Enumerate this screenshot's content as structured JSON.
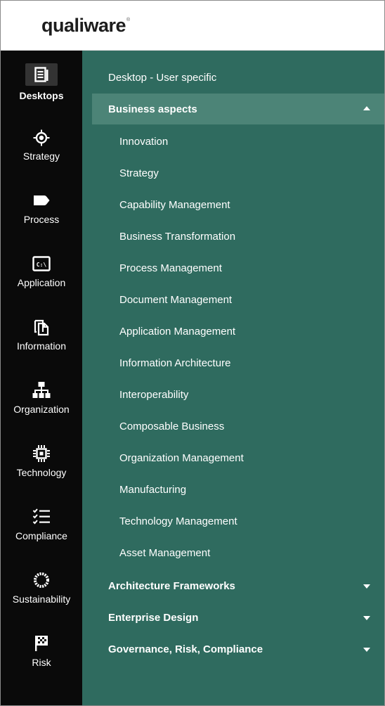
{
  "brand": {
    "name": "qualiware",
    "mark": "®"
  },
  "colors": {
    "rail": "#0a0a0a",
    "panel": "#2f6b5f",
    "active_row": "#4c8477",
    "text": "#ffffff"
  },
  "rail": {
    "items": [
      {
        "label": "Desktops",
        "icon": "desktops-icon",
        "active": true
      },
      {
        "label": "Strategy",
        "icon": "target-icon"
      },
      {
        "label": "Process",
        "icon": "process-tag-icon"
      },
      {
        "label": "Application",
        "icon": "terminal-icon"
      },
      {
        "label": "Information",
        "icon": "documents-icon"
      },
      {
        "label": "Organization",
        "icon": "org-chart-icon"
      },
      {
        "label": "Technology",
        "icon": "chip-icon"
      },
      {
        "label": "Compliance",
        "icon": "checklist-icon"
      },
      {
        "label": "Sustainability",
        "icon": "wreath-icon"
      },
      {
        "label": "Risk",
        "icon": "flag-icon"
      }
    ]
  },
  "menu": {
    "desktop_user": "Desktop - User specific",
    "business_aspects": {
      "label": "Business aspects",
      "expanded": true
    },
    "sub_items": [
      "Innovation",
      "Strategy",
      "Capability Management",
      "Business Transformation",
      "Process Management",
      "Document Management",
      "Application Management",
      "Information Architecture",
      "Interoperability",
      "Composable Business",
      "Organization Management",
      "Manufacturing",
      "Technology Management",
      "Asset Management"
    ],
    "collapsed_sections": [
      "Architecture Frameworks",
      "Enterprise Design",
      "Governance, Risk, Compliance"
    ]
  }
}
